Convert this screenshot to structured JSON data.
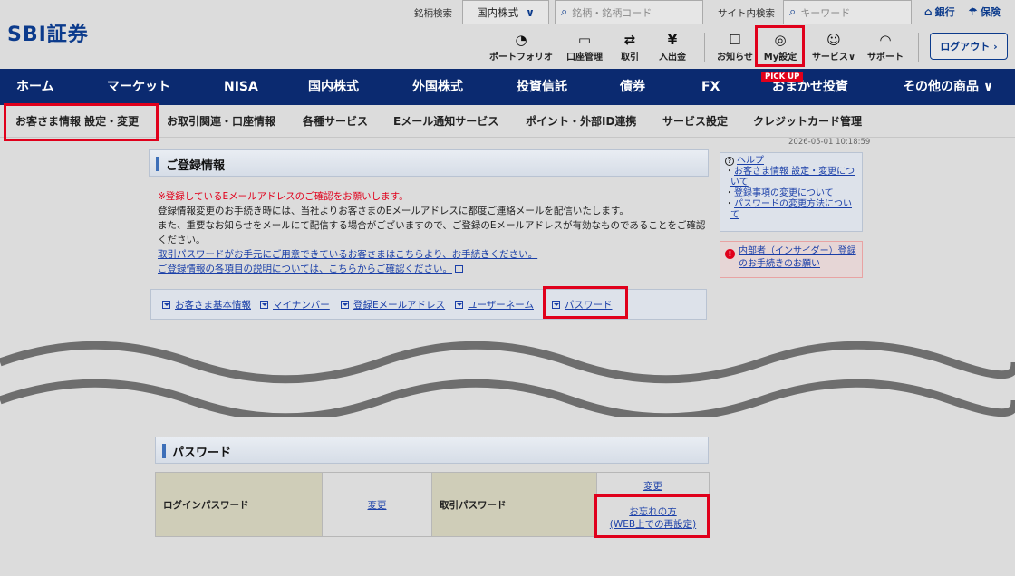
{
  "header": {
    "logo": "SBI証券",
    "stock_search_label": "銘柄検索",
    "market_select": "国内株式",
    "stock_search_placeholder": "銘柄・銘柄コード",
    "site_search_label": "サイト内検索",
    "site_search_placeholder": "キーワード",
    "bank_link": "銀行",
    "insurance_link": "保険",
    "icons": {
      "portfolio": "ポートフォリオ",
      "account": "口座管理",
      "trade": "取引",
      "deposit": "入出金",
      "notice": "お知らせ",
      "my_settings": "My設定",
      "services": "サービス",
      "support": "サポート"
    },
    "logout": "ログアウト"
  },
  "nav": {
    "items": [
      "ホーム",
      "マーケット",
      "NISA",
      "国内株式",
      "外国株式",
      "投資信託",
      "債券",
      "FX",
      "おまかせ投資",
      "その他の商品"
    ],
    "pickup": "PICK UP"
  },
  "subnav": {
    "items": [
      "お客さま情報 設定・変更",
      "お取引関連・口座情報",
      "各種サービス",
      "Eメール通知サービス",
      "ポイント・外部ID連携",
      "サービス設定",
      "クレジットカード管理"
    ]
  },
  "timestamp": "2026-05-01 10:18:59",
  "registration": {
    "title": "ご登録情報",
    "notice_red": "※登録しているEメールアドレスのご確認をお願いします。",
    "notice_line1": "登録情報変更のお手続き時には、当社よりお客さまのEメールアドレスに都度ご連絡メールを配信いたします。",
    "notice_line2": "また、重要なお知らせをメールにて配信する場合がございますので、ご登録のEメールアドレスが有効なものであることをご確認ください。",
    "link_password": "取引パスワードがお手元にご用意できているお客さまはこちらより、お手続きください。",
    "link_explain": "ご登録情報の各項目の説明については、こちらからご確認ください。",
    "anchors": [
      "お客さま基本情報",
      "マイナンバー",
      "登録Eメールアドレス",
      "ユーザーネーム",
      "パスワード"
    ]
  },
  "help": {
    "title": "ヘルプ",
    "links": [
      "お客さま情報 設定・変更について",
      "登録事項の変更について",
      "パスワードの変更方法について"
    ],
    "insider": "内部者（インサイダー）登録のお手続きのお願い"
  },
  "password_section": {
    "title": "パスワード",
    "login_label": "ログインパスワード",
    "login_change": "変更",
    "trade_label": "取引パスワード",
    "trade_change": "変更",
    "forgot_line1": "お忘れの方",
    "forgot_line2": "(WEB上での再設定)"
  }
}
